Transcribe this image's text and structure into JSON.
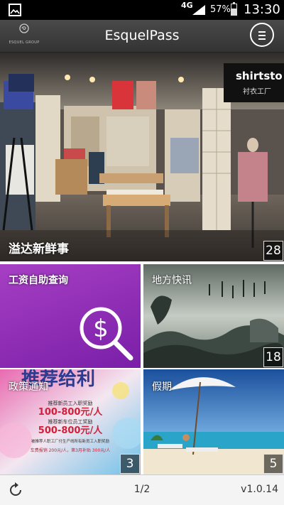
{
  "status_bar": {
    "network": "4G",
    "battery_percent": "57%",
    "battery_level": 0.57,
    "time": "13:30"
  },
  "header": {
    "logo_text": "ESQUEL GROUP",
    "title": "EsquelPass"
  },
  "tiles": [
    {
      "label": "溢达新鲜事",
      "count": "28",
      "shop_sign": "shirtsto",
      "shop_sign_sub": "衬衣工厂"
    },
    {
      "label": "工资自助查询",
      "icon_glyph": "$"
    },
    {
      "label": "地方快讯",
      "count": "18"
    },
    {
      "label": "政策通知",
      "count": "3",
      "poster_title": "推荐给利",
      "poster_lines": [
        "推荐新员工入职奖励",
        "100-800元/人",
        "推荐新车位员工奖励",
        "500-800元/人",
        "被推荐人职工厂付生产线所有新员工入职奖励",
        "车费报销 200元/人，第3月补贴 300元/人"
      ]
    },
    {
      "label": "假期",
      "count": "5"
    }
  ],
  "bottom_bar": {
    "page": "1/2",
    "version": "v1.0.14"
  },
  "colors": {
    "salary_tile": "#9b36bd",
    "header_bg": "#3f3f3f",
    "status_bar": "#000000"
  },
  "icons": {
    "status_left": "gallery-icon",
    "menu": "hamburger-menu-icon",
    "salary": "search-dollar-icon",
    "refresh": "refresh-icon"
  }
}
